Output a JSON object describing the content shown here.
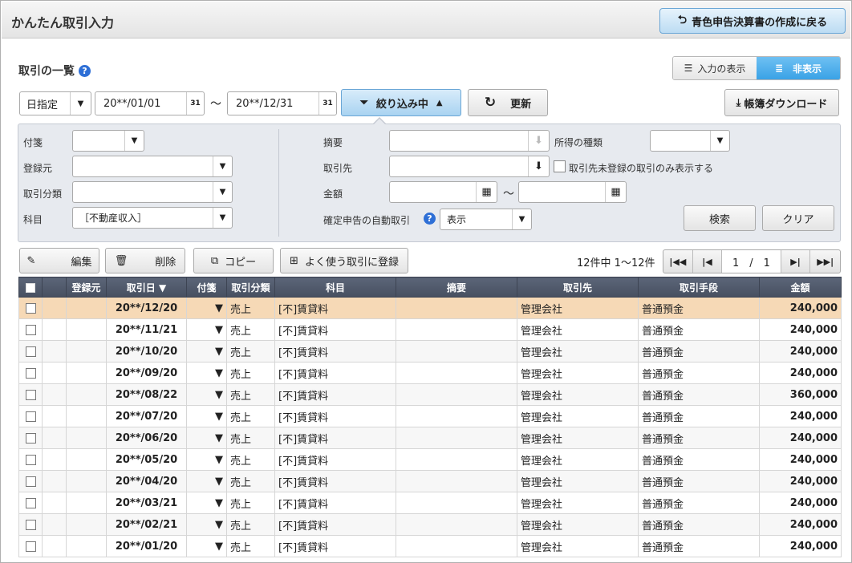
{
  "header": {
    "title": "かんたん取引入力",
    "back_label": "青色申告決算書の作成に戻る"
  },
  "section": {
    "title": "取引の一覧",
    "help": "?"
  },
  "view_toggle": {
    "show_input": "入力の表示",
    "hide": "非表示"
  },
  "toolbar": {
    "date_mode": "日指定",
    "date_from": "20**/01/01",
    "date_to": "20**/12/31",
    "date_separator": "～",
    "calendar_glyph": "31",
    "filter_label": "絞り込み中",
    "refresh_label": "更新",
    "download_label": "帳簿ダウンロード"
  },
  "filters": {
    "sticky_label": "付箋",
    "source_label": "登録元",
    "category_label": "取引分類",
    "account_label": "科目",
    "account_value": "［不動産収入］",
    "summary_label": "摘要",
    "income_type_label": "所得の種類",
    "partner_label": "取引先",
    "partner_only_label": "取引先未登録の取引のみ表示する",
    "amount_label": "金額",
    "amount_separator": "～",
    "auto_label": "確定申告の自動取引",
    "auto_value": "表示",
    "search_label": "検索",
    "clear_label": "クリア"
  },
  "actions": {
    "edit": "編集",
    "delete": "削除",
    "copy": "コピー",
    "favorite": "よく使う取引に登録",
    "count_text": "12件中 1～12件",
    "page_text": "1　/　1"
  },
  "table": {
    "headers": {
      "source": "登録元",
      "date": "取引日 ▼",
      "sticky": "付箋",
      "category": "取引分類",
      "account": "科目",
      "summary": "摘要",
      "partner": "取引先",
      "method": "取引手段",
      "amount": "金額"
    },
    "rows": [
      {
        "date": "20**/12/20",
        "category": "売上",
        "account": "[不]賃貸料",
        "partner": "管理会社",
        "method": "普通預金",
        "amount": "240,000"
      },
      {
        "date": "20**/11/21",
        "category": "売上",
        "account": "[不]賃貸料",
        "partner": "管理会社",
        "method": "普通預金",
        "amount": "240,000"
      },
      {
        "date": "20**/10/20",
        "category": "売上",
        "account": "[不]賃貸料",
        "partner": "管理会社",
        "method": "普通預金",
        "amount": "240,000"
      },
      {
        "date": "20**/09/20",
        "category": "売上",
        "account": "[不]賃貸料",
        "partner": "管理会社",
        "method": "普通預金",
        "amount": "240,000"
      },
      {
        "date": "20**/08/22",
        "category": "売上",
        "account": "[不]賃貸料",
        "partner": "管理会社",
        "method": "普通預金",
        "amount": "360,000"
      },
      {
        "date": "20**/07/20",
        "category": "売上",
        "account": "[不]賃貸料",
        "partner": "管理会社",
        "method": "普通預金",
        "amount": "240,000"
      },
      {
        "date": "20**/06/20",
        "category": "売上",
        "account": "[不]賃貸料",
        "partner": "管理会社",
        "method": "普通預金",
        "amount": "240,000"
      },
      {
        "date": "20**/05/20",
        "category": "売上",
        "account": "[不]賃貸料",
        "partner": "管理会社",
        "method": "普通預金",
        "amount": "240,000"
      },
      {
        "date": "20**/04/20",
        "category": "売上",
        "account": "[不]賃貸料",
        "partner": "管理会社",
        "method": "普通預金",
        "amount": "240,000"
      },
      {
        "date": "20**/03/21",
        "category": "売上",
        "account": "[不]賃貸料",
        "partner": "管理会社",
        "method": "普通預金",
        "amount": "240,000"
      },
      {
        "date": "20**/02/21",
        "category": "売上",
        "account": "[不]賃貸料",
        "partner": "管理会社",
        "method": "普通預金",
        "amount": "240,000"
      },
      {
        "date": "20**/01/20",
        "category": "売上",
        "account": "[不]賃貸料",
        "partner": "管理会社",
        "method": "普通預金",
        "amount": "240,000"
      }
    ]
  },
  "icons": {
    "back": "return-arrow-icon",
    "filter": "funnel-icon",
    "refresh": "refresh-icon",
    "download": "download-icon",
    "calendar": "calendar-icon",
    "calculator": "calculator-icon"
  },
  "colors": {
    "accent": "#3aa2e6",
    "selected_row": "#f6d9b6",
    "table_header": "#505a6c",
    "help": "#2e6fd6"
  }
}
